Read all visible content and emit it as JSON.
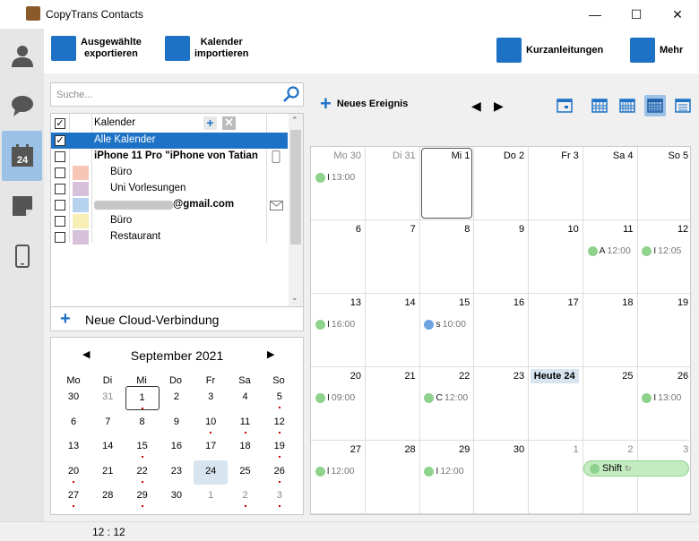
{
  "window": {
    "title": "CopyTrans Contacts",
    "controls": [
      "minimize",
      "maximize",
      "close"
    ]
  },
  "sidebar": {
    "items": [
      {
        "icon": "person-icon"
      },
      {
        "icon": "speech-bubble-icon"
      },
      {
        "icon": "calendar-icon",
        "badge": "24",
        "active": true
      },
      {
        "icon": "note-icon"
      },
      {
        "icon": "phone-icon"
      }
    ]
  },
  "toolbar": {
    "export_label_1": "Ausgewählte",
    "export_label_2": "exportieren",
    "import_label_1": "Kalender",
    "import_label_2": "importieren",
    "guides_label": "Kurzanleitungen",
    "more_label": "Mehr"
  },
  "search": {
    "placeholder": "Suche..."
  },
  "calendars": {
    "header_label": "Kalender",
    "rows": [
      {
        "label": "Alle Kalender",
        "selected": true,
        "color": ""
      },
      {
        "label": "iPhone 11 Pro \"iPhone von Tatian",
        "bold": true,
        "color": ""
      },
      {
        "label": "Büro",
        "color": "#f7c6b6"
      },
      {
        "label": "Uni Vorlesungen",
        "color": "#d7c1da"
      },
      {
        "label": "@gmail.com",
        "bold": true,
        "color": "#b5d3ee"
      },
      {
        "label": "Büro",
        "color": "#f7efb6"
      },
      {
        "label": "Restaurant",
        "color": "#d7c1da"
      }
    ],
    "new_cloud_label": "Neue Cloud-Verbindung"
  },
  "minical": {
    "month_label": "September 2021",
    "dow": [
      "Mo",
      "Di",
      "Mi",
      "Do",
      "Fr",
      "Sa",
      "So"
    ],
    "weeks": [
      [
        "30",
        "31",
        "1",
        "2",
        "3",
        "4",
        "5"
      ],
      [
        "6",
        "7",
        "8",
        "9",
        "10",
        "11",
        "12"
      ],
      [
        "13",
        "14",
        "15",
        "16",
        "17",
        "18",
        "19"
      ],
      [
        "20",
        "21",
        "22",
        "23",
        "24",
        "25",
        "26"
      ],
      [
        "27",
        "28",
        "29",
        "30",
        "1",
        "2",
        "3"
      ]
    ]
  },
  "calview": {
    "new_event_label": "Neues Ereignis",
    "day_headers": [
      "Mo 30",
      "Di 31",
      "Mi 1",
      "Do 2",
      "Fr 3",
      "Sa 4",
      "So 5"
    ],
    "week_days": [
      [
        "Mo 30",
        "Di 31",
        "Mi 1",
        "Do 2",
        "Fr 3",
        "Sa 4",
        "So 5"
      ],
      [
        "6",
        "7",
        "8",
        "9",
        "10",
        "11",
        "12"
      ],
      [
        "13",
        "14",
        "15",
        "16",
        "17",
        "18",
        "19"
      ],
      [
        "20",
        "21",
        "22",
        "23",
        "Heute 24",
        "25",
        "26"
      ],
      [
        "27",
        "28",
        "29",
        "30",
        "1",
        "2",
        "3"
      ]
    ],
    "events": [
      {
        "label": "13:00",
        "prefix": "I"
      },
      {
        "label": "12:00",
        "prefix": "A"
      },
      {
        "label": "12:05",
        "prefix": "I"
      },
      {
        "label": "16:00",
        "prefix": "I"
      },
      {
        "label": "10:00",
        "prefix": "s"
      },
      {
        "label": "09:00",
        "prefix": "I"
      },
      {
        "label": "12:00",
        "prefix": "C"
      },
      {
        "label": "13:00",
        "prefix": "I"
      },
      {
        "label": "12:00",
        "prefix": "l"
      },
      {
        "label": "12:00",
        "prefix": "I"
      },
      {
        "label": "Shift",
        "prefix": ""
      }
    ]
  },
  "status": {
    "time": "12 : 12"
  }
}
